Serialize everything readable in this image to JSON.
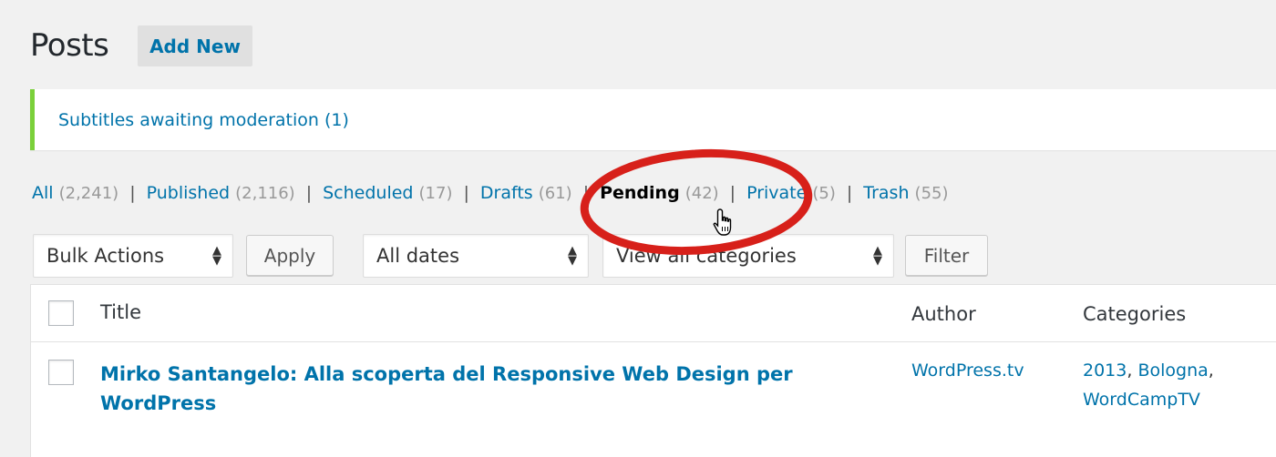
{
  "header": {
    "title": "Posts",
    "add_new_label": "Add New"
  },
  "notice": {
    "text": "Subtitles awaiting moderation (1)"
  },
  "status_filters": [
    {
      "label": "All",
      "count": "(2,241)",
      "current": false
    },
    {
      "label": "Published",
      "count": "(2,116)",
      "current": false
    },
    {
      "label": "Scheduled",
      "count": "(17)",
      "current": false
    },
    {
      "label": "Drafts",
      "count": "(61)",
      "current": false
    },
    {
      "label": "Pending",
      "count": "(42)",
      "current": true
    },
    {
      "label": "Private",
      "count": "(5)",
      "current": false
    },
    {
      "label": "Trash",
      "count": "(55)",
      "current": false
    }
  ],
  "separator": "|",
  "controls": {
    "bulk_actions": "Bulk Actions",
    "apply_label": "Apply",
    "dates": "All dates",
    "categories": "View all categories",
    "filter_label": "Filter"
  },
  "table": {
    "columns": {
      "title": "Title",
      "author": "Author",
      "categories": "Categories"
    },
    "rows": [
      {
        "title": "Mirko Santangelo: Alla scoperta del Responsive Web Design per WordPress",
        "author": "WordPress.tv",
        "categories": [
          "2013",
          "Bologna",
          "WordCampTV"
        ]
      }
    ]
  },
  "colors": {
    "link": "#0073aa",
    "notice_border": "#7ad03a",
    "annotation_circle": "#d7201a"
  },
  "icons": {
    "select_arrows": "up-down-arrows-icon",
    "cursor": "hand-pointer-cursor-icon"
  }
}
